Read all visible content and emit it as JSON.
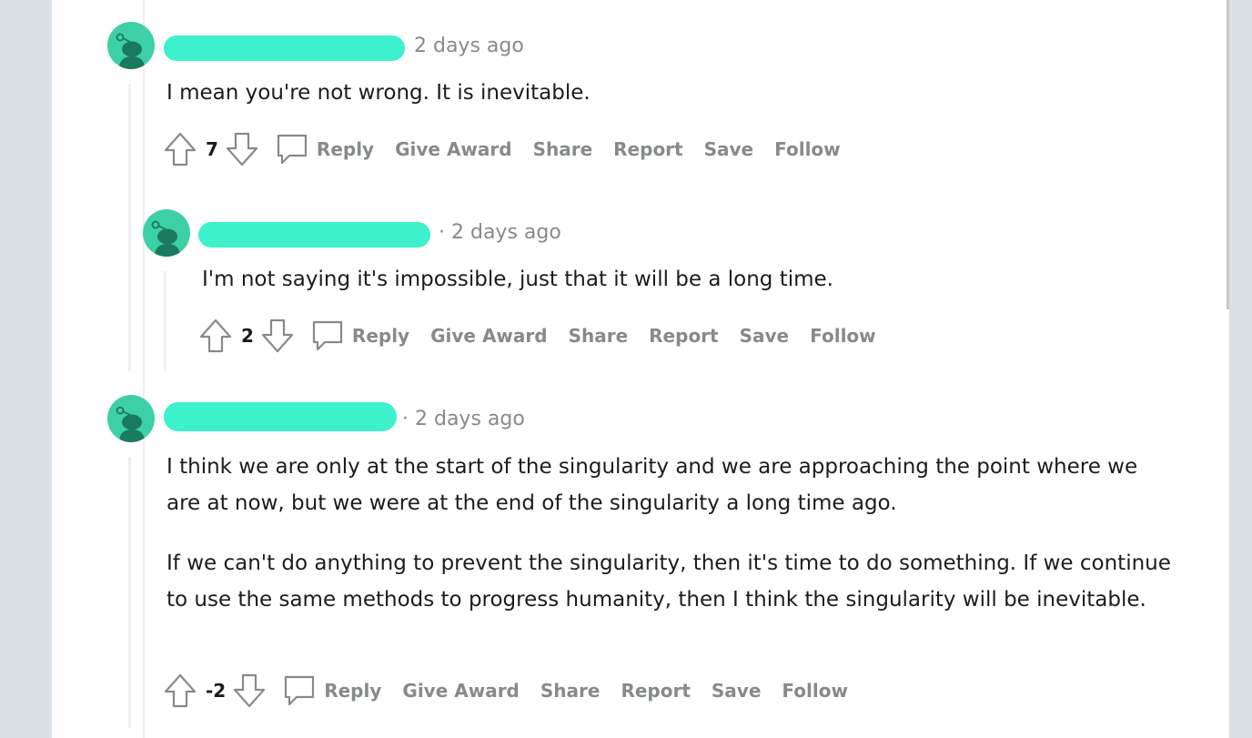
{
  "comments": [
    {
      "timestamp": "2 days ago",
      "text": [
        "I mean you're not wrong. It is inevitable."
      ],
      "votes": "7",
      "actions": {
        "reply": "Reply",
        "award": "Give Award",
        "share": "Share",
        "report": "Report",
        "save": "Save",
        "follow": "Follow"
      }
    },
    {
      "timestamp": "· 2 days ago",
      "text": [
        "I'm not saying it's impossible, just that it will be a long time."
      ],
      "votes": "2",
      "actions": {
        "reply": "Reply",
        "award": "Give Award",
        "share": "Share",
        "report": "Report",
        "save": "Save",
        "follow": "Follow"
      }
    },
    {
      "timestamp": "· 2 days ago",
      "text": [
        "I think we are only at the start of the singularity and we are approaching the point where we are at now, but we were at the end of the singularity a long time ago.",
        "If we can't do anything to prevent the singularity, then it's time to do something. If we continue to use the same methods to progress humanity, then I think the singularity will be inevitable."
      ],
      "votes": "-2",
      "actions": {
        "reply": "Reply",
        "award": "Give Award",
        "share": "Share",
        "report": "Report",
        "save": "Save",
        "follow": "Follow"
      }
    }
  ],
  "colors": {
    "avatar": "#3ed0a5",
    "redaction": "#3cf1cc",
    "meta": "#878a8c"
  }
}
